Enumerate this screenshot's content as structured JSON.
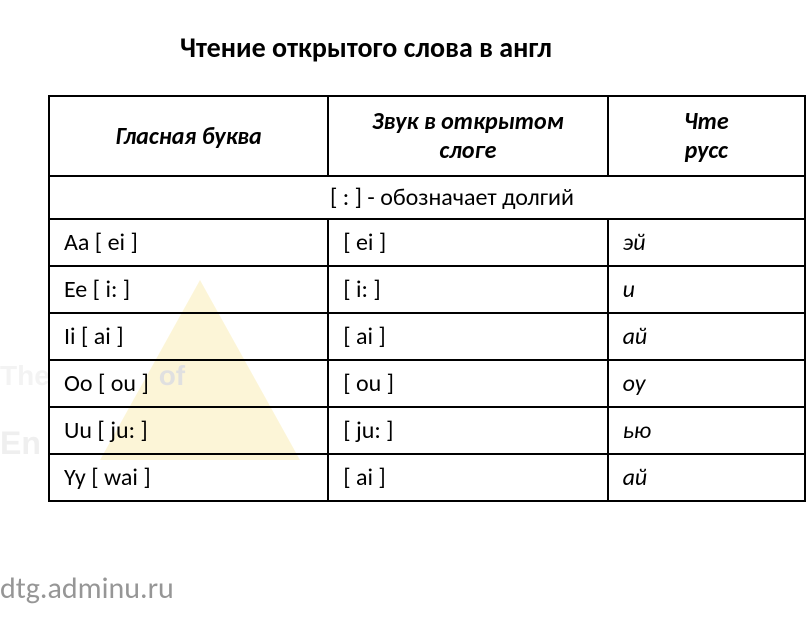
{
  "title": "Чтение открытого слова в англ",
  "chart_data": {
    "type": "table",
    "headers": {
      "col1": "Гласная буква",
      "col2": "Звук в открытом слоге",
      "col3_line1": "Чте",
      "col3_line2": "русс"
    },
    "note": "[ : ]    - обозначает долгий",
    "rows": [
      {
        "letter": "Aa [ ei ]",
        "sound": "[ ei ]",
        "reading": "эй"
      },
      {
        "letter": "Ee [ i: ]",
        "sound": "[ i: ]",
        "reading": "и"
      },
      {
        "letter": "Ii [ ai ]",
        "sound": "[ ai ]",
        "reading": "ай"
      },
      {
        "letter": "Oo [ ou ]",
        "sound": "[ ou ]",
        "reading": "оу"
      },
      {
        "letter": "Uu [ ju: ]",
        "sound": "[ ju: ]",
        "reading": "ью"
      },
      {
        "letter": "Yy [ wai ]",
        "sound": "[ ai ]",
        "reading": "ай"
      }
    ]
  },
  "watermark": {
    "text1_part1": "The",
    "text1_part2": "of",
    "text2": "En"
  },
  "footer_url": "dtg.adminu.ru"
}
